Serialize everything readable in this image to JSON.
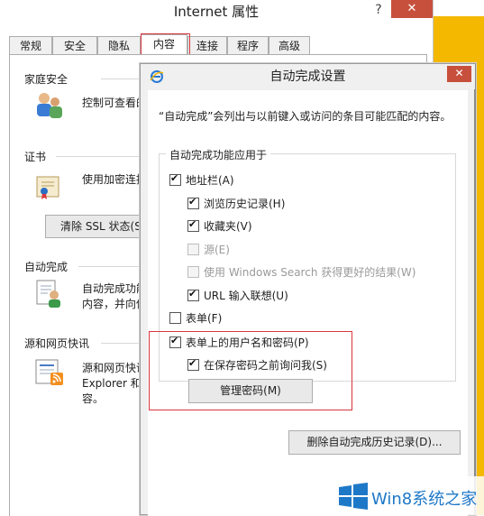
{
  "main_window": {
    "title": "Internet 属性",
    "help": "?",
    "close": "✕",
    "tabs": [
      "常规",
      "安全",
      "隐私",
      "内容",
      "连接",
      "程序",
      "高级"
    ]
  },
  "content_tab": {
    "family_safety": {
      "title": "家庭安全",
      "text": "控制可查看的"
    },
    "certificates": {
      "title": "证书",
      "text": "使用加密连接",
      "ssl_button": "清除 SSL 状态(S)"
    },
    "autocomplete": {
      "title": "自动完成",
      "text_line1": "自动完成功能",
      "text_line2": "内容，并向你"
    },
    "feeds": {
      "title": "源和网页快讯",
      "text_line1": "源和网页快讯",
      "text_line2": "Explorer 和",
      "text_line3": "容。"
    }
  },
  "autocomplete_dialog": {
    "title": "自动完成设置",
    "close": "✕",
    "description": "“自动完成”会列出与以前键入或访问的条目可能匹配的内容。",
    "group_label": "自动完成功能应用于",
    "options": [
      {
        "label": "地址栏(A)",
        "checked": true,
        "disabled": false
      },
      {
        "label": "浏览历史记录(H)",
        "checked": true,
        "disabled": false
      },
      {
        "label": "收藏夹(V)",
        "checked": true,
        "disabled": false
      },
      {
        "label": "源(E)",
        "checked": false,
        "disabled": true
      },
      {
        "label": "使用 Windows Search 获得更好的结果(W)",
        "checked": false,
        "disabled": true
      },
      {
        "label": "URL 输入联想(U)",
        "checked": true,
        "disabled": false
      },
      {
        "label": "表单(F)",
        "checked": false,
        "disabled": false
      },
      {
        "label": "表单上的用户名和密码(P)",
        "checked": true,
        "disabled": false
      },
      {
        "label": "在保存密码之前询问我(S)",
        "checked": true,
        "disabled": false
      }
    ],
    "manage_passwords_button": "管理密码(M)",
    "clear_history_button": "删除自动完成历史记录(D)..."
  },
  "watermark": {
    "text": "Win8系统之家"
  },
  "colors": {
    "accent_red": "#c7503c",
    "highlight_red": "#d9363e",
    "strip_yellow": "#f4b800",
    "watermark_blue": "#1e78c8"
  }
}
